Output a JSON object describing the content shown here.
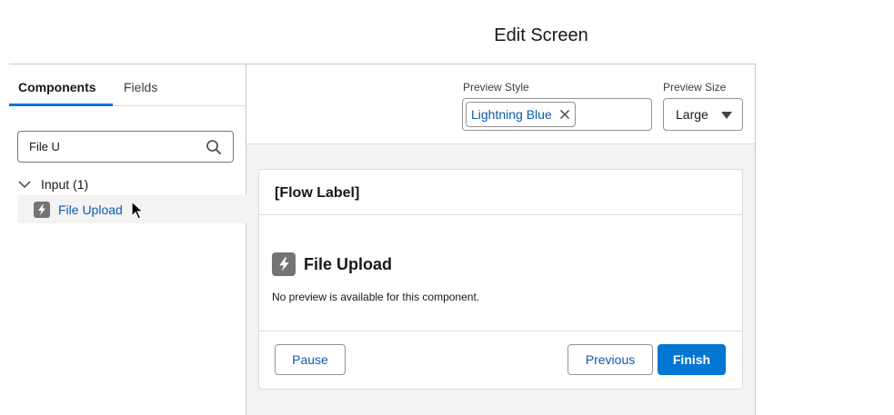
{
  "header": {
    "title": "Edit Screen"
  },
  "left_panel": {
    "tabs": [
      {
        "label": "Components",
        "active": true
      },
      {
        "label": "Fields",
        "active": false
      }
    ],
    "search": {
      "value": "File U",
      "icon": "search-icon"
    },
    "group": {
      "label": "Input (1)",
      "expanded": true,
      "icon": "chevron-down-icon"
    },
    "items": [
      {
        "label": "File Upload",
        "icon": "bolt-icon",
        "hovered": true
      }
    ]
  },
  "preview_bar": {
    "style_label": "Preview Style",
    "style_value": "Lightning Blue",
    "size_label": "Preview Size",
    "size_value": "Large"
  },
  "flow_card": {
    "label": "[Flow Label]",
    "component_title": "File Upload",
    "component_icon": "bolt-icon",
    "no_preview_text": "No preview is available for this component.",
    "buttons": {
      "pause": "Pause",
      "previous": "Previous",
      "finish": "Finish"
    }
  },
  "colors": {
    "brand": "#0176d3",
    "link": "#0b5cab",
    "icon_gray": "#747474",
    "panel_bg": "#f3f3f3"
  }
}
